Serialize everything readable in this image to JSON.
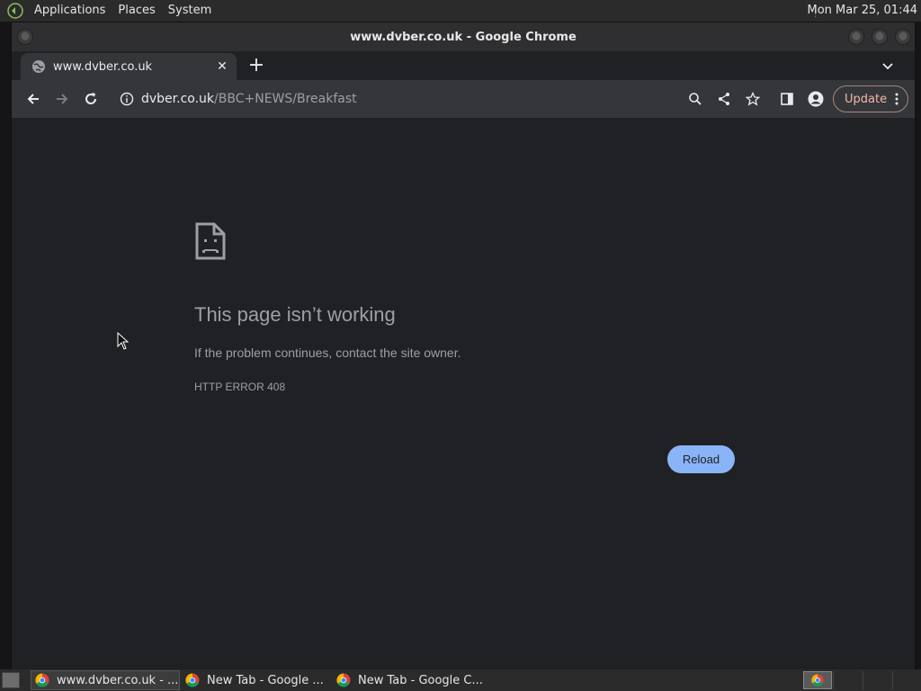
{
  "top_panel": {
    "menu": [
      "Applications",
      "Places",
      "System"
    ],
    "clock": "Mon Mar 25, 01:44"
  },
  "window": {
    "title": "www.dvber.co.uk - Google Chrome"
  },
  "tabs": [
    {
      "title": "www.dvber.co.uk",
      "icon": "globe-icon",
      "active": true
    }
  ],
  "omnibox": {
    "host": "dvber.co.uk",
    "path": "/BBC+NEWS/Breakfast"
  },
  "toolbar": {
    "update_label": "Update"
  },
  "error_page": {
    "title": "This page isn’t working",
    "description": "If the problem continues, contact the site owner.",
    "code": "HTTP ERROR 408",
    "reload_label": "Reload"
  },
  "taskbar": {
    "tasks": [
      {
        "label": "www.dvber.co.uk - ...",
        "active": true
      },
      {
        "label": "New Tab - Google ...",
        "active": false
      },
      {
        "label": "New Tab - Google C...",
        "active": false
      }
    ]
  },
  "colors": {
    "accent": "#8ab4f8",
    "update_text": "#f2b8a8",
    "page_bg": "#202124"
  }
}
